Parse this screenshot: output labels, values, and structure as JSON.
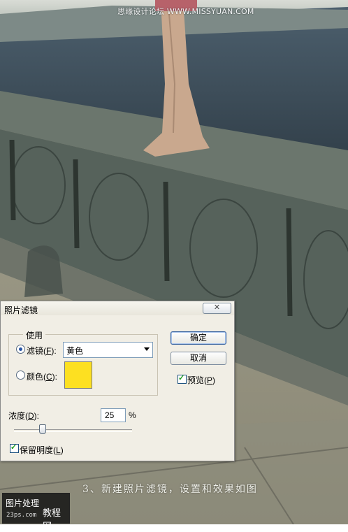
{
  "watermark": "思缘设计论坛  WWW.MISSYUAN.COM",
  "caption": "3、新建照片滤镜，设置和效果如图",
  "logo": {
    "line1": "图片处理",
    "line2": "教程网",
    "line3": "23ps.com"
  },
  "dialog": {
    "title": "照片滤镜",
    "close_icon": "close-icon",
    "group_label": "使用",
    "filter_radio": {
      "label": "滤镜(",
      "key": "F",
      "suffix": "):",
      "checked": true
    },
    "filter_select": {
      "value": "黄色"
    },
    "color_radio": {
      "label": "颜色(",
      "key": "C",
      "suffix": "):",
      "checked": false
    },
    "color_swatch": "#fde021",
    "ok_label": "确定",
    "cancel_label": "取消",
    "preview": {
      "label": "预览(",
      "key": "P",
      "suffix": ")",
      "checked": true
    },
    "density": {
      "label": "浓度(",
      "key": "D",
      "suffix": "):",
      "value": "25",
      "unit": "%",
      "percent": 25
    },
    "preserve": {
      "label": "保留明度(",
      "key": "L",
      "suffix": ")",
      "checked": true
    }
  },
  "colors": {
    "dialog_bg": "#f1eee5",
    "water": "#3d4c58",
    "stone": "#5e6a62",
    "ground": "#9a9682"
  }
}
